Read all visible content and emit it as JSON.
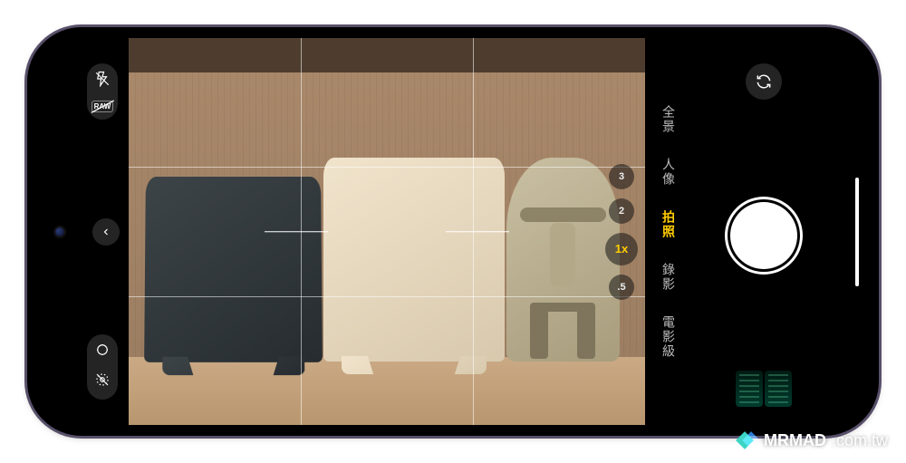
{
  "watermark": {
    "brand": "MRMAD",
    "suffix": ".com.tw"
  },
  "left_controls": {
    "flash": "off",
    "raw_label": "RAW",
    "live_photo": "off",
    "filters": "off"
  },
  "zoom": {
    "options": [
      "3",
      "2",
      "1x",
      ".5"
    ],
    "active": "1x"
  },
  "modes": {
    "items": [
      "電影級",
      "錄影",
      "拍照",
      "人像",
      "全景"
    ],
    "active": "拍照"
  },
  "right_controls": {
    "switch_camera": "switch",
    "shutter": "capture",
    "last_photo": "thumbnail"
  }
}
